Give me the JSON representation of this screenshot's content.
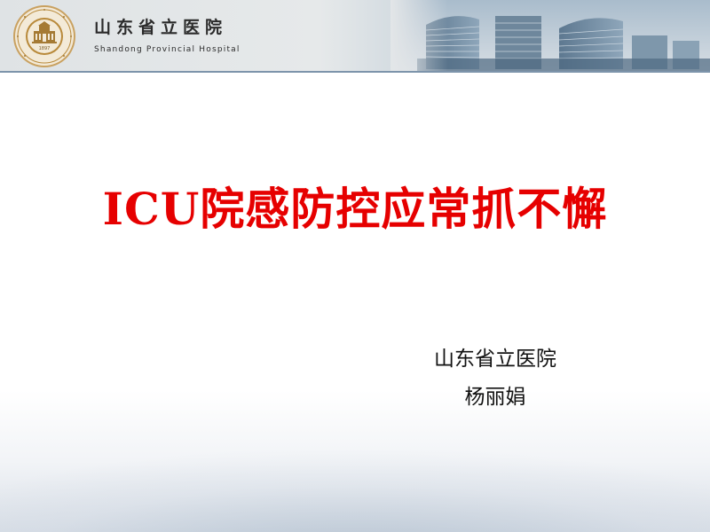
{
  "header": {
    "hospital_name_cn": "山东省立医院",
    "hospital_name_en": "Shandong Provincial Hospital",
    "logo": {
      "icon": "hospital-seal-logo",
      "year": "1897"
    },
    "banner_image": "hospital-buildings-skyline"
  },
  "slide": {
    "title": "ICU院感防控应常抓不懈",
    "author_org": "山东省立医院",
    "author_name": "杨丽娟"
  },
  "colors": {
    "title": "#e60000",
    "header_band": "#dfe3e5",
    "header_line": "#7d94ab",
    "logo_gold": "#b8893a"
  }
}
